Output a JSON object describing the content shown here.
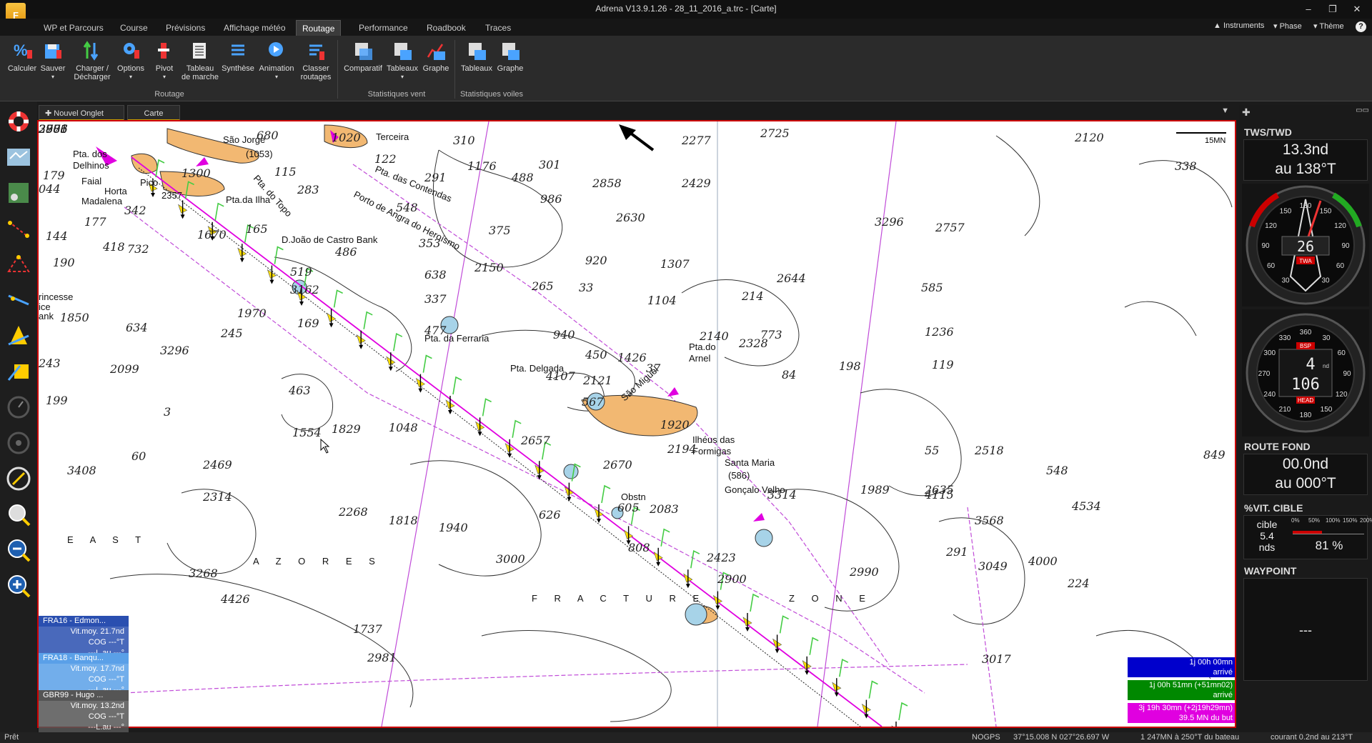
{
  "window": {
    "title": "Adrena V13.9.1.26 - 28_11_2016_a.trc - [Carte]",
    "logo_letter": "F"
  },
  "menu": {
    "tabs": [
      "WP et Parcours",
      "Course",
      "Prévisions",
      "Affichage météo",
      "Routage",
      "Performance",
      "Roadbook",
      "Traces"
    ],
    "active": "Routage",
    "right": [
      "Instruments",
      "Phase",
      "Thème"
    ]
  },
  "ribbon": {
    "buttons": [
      {
        "label": "Calculer",
        "icon": "calculate-icon"
      },
      {
        "label": "Sauver",
        "icon": "save-icon"
      },
      {
        "label": "Charger /\nDécharger",
        "icon": "load-icon"
      },
      {
        "label": "Options",
        "icon": "options-icon"
      },
      {
        "label": "Pivot",
        "icon": "pivot-icon"
      },
      {
        "label": "Tableau\nde marche",
        "icon": "table-icon"
      },
      {
        "label": "Synthèse",
        "icon": "synthesis-icon"
      },
      {
        "label": "Animation",
        "icon": "animation-icon"
      },
      {
        "label": "Classer\nroutages",
        "icon": "sort-icon"
      },
      {
        "label": "Comparatif",
        "icon": "compare-icon"
      },
      {
        "label": "Tableaux",
        "icon": "tables-icon"
      },
      {
        "label": "Graphe",
        "icon": "graph-icon"
      },
      {
        "label": "Tableaux",
        "icon": "tables-icon"
      },
      {
        "label": "Graphe",
        "icon": "graph-icon"
      }
    ],
    "groups": [
      "Routage",
      "Statistiques vent",
      "Statistiques voiles"
    ]
  },
  "doc_tabs": {
    "new_tab": "Nouvel Onglet",
    "current": "Carte"
  },
  "map": {
    "scale_label": "15MN",
    "places": [
      "São Jorge",
      "(1053)",
      "Terceira",
      "Pta. dos",
      "Delhinos",
      "Faial",
      "Horta",
      "Madalena",
      "Pico",
      "2357",
      "Pta.da Ilha",
      "Pta. do Topo",
      "Porto de Angra do Heroísmo",
      "Pta. das Contendas",
      "D.João de Castro Bank",
      "Pta. da Ferraria",
      "São Miguel",
      "Pta. Delgada",
      "Pta.do",
      "Arnel",
      "Ilhéus das",
      "Formigas",
      "Santa Maria",
      "(586)",
      "Gonçalo Velho",
      "Obstn",
      "rincesse",
      "ice",
      "ank",
      "E A S T",
      "A Z O R E S",
      "F R A C T U R E",
      "Z O N E"
    ],
    "depths": [
      "680",
      "1020",
      "310",
      "2277",
      "2725",
      "2120",
      "338",
      "179",
      "044",
      "1300",
      "115",
      "283",
      "291",
      "1176",
      "301",
      "488",
      "986",
      "2858",
      "2429",
      "177",
      "342",
      "1670",
      "165",
      "548",
      "122",
      "353",
      "375",
      "2630",
      "3296",
      "2757",
      "144",
      "418",
      "732",
      "486",
      "519",
      "638",
      "2150",
      "920",
      "1307",
      "190",
      "265",
      "33",
      "1104",
      "214",
      "2644",
      "585",
      "3162",
      "337",
      "940",
      "1970",
      "169",
      "477",
      "2140",
      "773",
      "1850",
      "634",
      "245",
      "450",
      "1426",
      "37",
      "1236",
      "119",
      "3296",
      "4107",
      "2121",
      "84",
      "198",
      "243",
      "2099",
      "463",
      "567",
      "2328",
      "199",
      "3",
      "1829",
      "1048",
      "1554",
      "1920",
      "2194",
      "849",
      "55",
      "60",
      "2469",
      "2657",
      "2670",
      "605",
      "2518",
      "548",
      "3408",
      "2314",
      "2268",
      "2635",
      "626",
      "2083",
      "3314",
      "4115",
      "1818",
      "1940",
      "3568",
      "4534",
      "808",
      "1989",
      "3000",
      "2423",
      "291",
      "4000",
      "2990",
      "3268",
      "2900",
      "224",
      "3017",
      "2981",
      "3049",
      "1737",
      "4426",
      "38",
      "2981",
      "2706",
      "2873",
      "2986"
    ]
  },
  "boats": [
    {
      "name": "FRA16 - Edmon...",
      "speed": "Vit.moy. 21.7nd",
      "cog": "COG  ---°T",
      "lau": "---L.au ---°",
      "color": "#2a4fb0"
    },
    {
      "name": "FRA18 - Banqu...",
      "speed": "Vit.moy. 17.7nd",
      "cog": "COG  ---°T",
      "lau": "---L.au ---°",
      "color": "#5aa0e8"
    },
    {
      "name": "GBR99 - Hugo ...",
      "speed": "Vit.moy. 13.2nd",
      "cog": "COG  ---°T",
      "lau": "---L.au ---°",
      "color": "#555555"
    }
  ],
  "eta": [
    {
      "line1": "1j 00h 00mn",
      "line2": "arrivé",
      "color": "#0000cc"
    },
    {
      "line1": "1j 00h 51mn (+51mn02)",
      "line2": "arrivé",
      "color": "#008800"
    },
    {
      "line1": "3j 19h 30mn (+2j19h29mn)",
      "line2": "39.5 MN du but",
      "color": "#e000e0"
    }
  ],
  "instruments": {
    "tws_header": "TWS/TWD",
    "tws_speed": "13.3nd",
    "tws_dir": "au 138°T",
    "twa_value": "26",
    "twa_label": "TWA",
    "gauge1_ticks": [
      "30",
      "60",
      "90",
      "120",
      "150",
      "180",
      "150",
      "120",
      "90",
      "60",
      "30"
    ],
    "bsp_label": "BSP",
    "bsp_value": "4",
    "bsp_unit": "nd",
    "head_value": "106",
    "head_label": "HEAD",
    "gauge2_ticks": [
      "90",
      "120",
      "150",
      "180",
      "210",
      "240",
      "270",
      "300",
      "330",
      "360",
      "30",
      "60"
    ],
    "route_header": "ROUTE FOND",
    "route_speed": "00.0nd",
    "route_dir": "au 000°T",
    "vit_header": "%VIT. CIBLE",
    "vit_label": "cible",
    "vit_target": "5.4",
    "vit_unit": "nds",
    "vit_percent": "81 %",
    "vit_scale": [
      "0%",
      "50%",
      "100%",
      "150%",
      "200%"
    ],
    "waypoint_header": "WAYPOINT",
    "waypoint_value": "---"
  },
  "status": {
    "ready": "Prêt",
    "gps": "NOGPS",
    "position": "37°15.008 N  027°26.697 W",
    "distance": "1 247MN à 250°T du bateau",
    "current": "courant 0.2nd au 213°T"
  }
}
